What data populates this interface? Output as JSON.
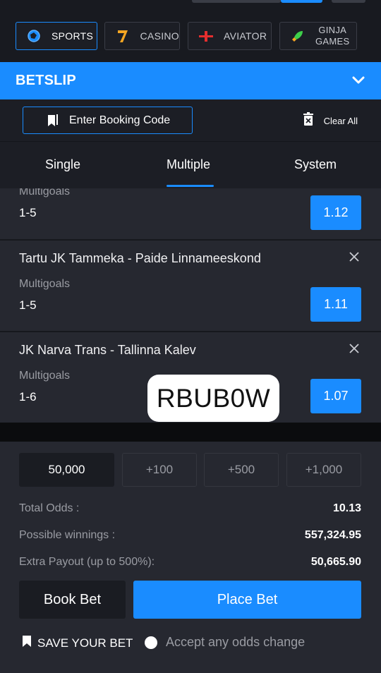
{
  "colors": {
    "accent": "#1a8cff",
    "background": "#1f2129",
    "card": "#262830"
  },
  "nav": {
    "tabs": [
      {
        "label": "SPORTS",
        "icon": "soccer-ball-icon",
        "active": true
      },
      {
        "label": "CASINO",
        "icon": "seven-icon",
        "active": false
      },
      {
        "label": "AVIATOR",
        "icon": "airplane-icon",
        "active": false
      },
      {
        "label": "GINJA GAMES",
        "label_line1": "GINJA",
        "label_line2": "GAMES",
        "icon": "rocket-icon",
        "active": false
      }
    ]
  },
  "betslip": {
    "title": "BETSLIP",
    "booking_label": "Enter Booking Code",
    "clear_label": "Clear All"
  },
  "tabs": [
    {
      "label": "Single"
    },
    {
      "label": "Multiple",
      "active": true
    },
    {
      "label": "System"
    }
  ],
  "bets": [
    {
      "match": "",
      "market": "Multigoals",
      "pick": "1-5",
      "odds": "1.12"
    },
    {
      "match": "Tartu JK Tammeka - Paide Linnameeskond",
      "market": "Multigoals",
      "pick": "1-5",
      "odds": "1.11"
    },
    {
      "match": "JK Narva Trans - Tallinna Kalev",
      "market": "Multigoals",
      "pick": "1-6",
      "odds": "1.07"
    }
  ],
  "watermark": "RBUB0W",
  "stake": {
    "amount": "50,000",
    "quick": [
      "+100",
      "+500",
      "+1,000"
    ]
  },
  "summary": {
    "total_odds_label": "Total Odds :",
    "total_odds": "10.13",
    "winnings_label": "Possible winnings :",
    "winnings": "557,324.95",
    "extra_label": "Extra Payout (up to 500%):",
    "extra": "50,665.90"
  },
  "actions": {
    "book_bet": "Book Bet",
    "place_bet": "Place Bet",
    "save": "SAVE YOUR BET",
    "accept": "Accept any odds change"
  }
}
